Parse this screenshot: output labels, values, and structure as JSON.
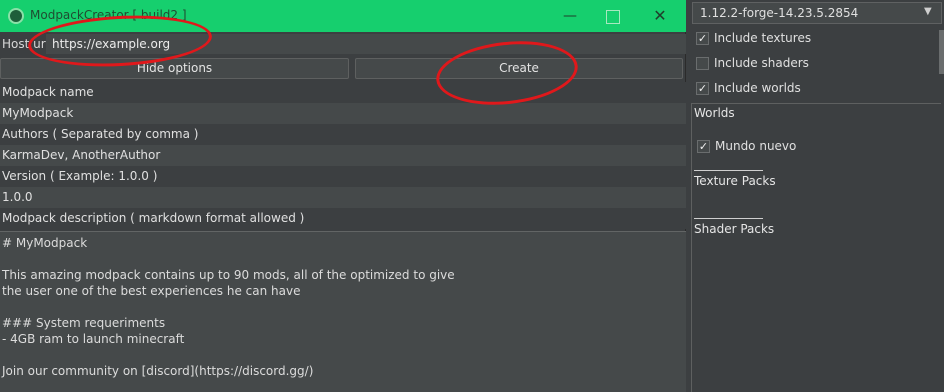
{
  "window": {
    "title": "ModpackCreator [ build2 ]",
    "minimize_glyph": "—",
    "close_glyph": "✕"
  },
  "host": {
    "label": "Host url",
    "value": "https://example.org"
  },
  "buttons": {
    "hide": "Hide options",
    "create": "Create"
  },
  "form": {
    "name_label": "Modpack name",
    "name_value": "MyModpack",
    "authors_label": "Authors ( Separated by comma )",
    "authors_value": "KarmaDev, AnotherAuthor",
    "version_label": "Version ( Example: 1.0.0 )",
    "version_value": "1.0.0",
    "description_label": "Modpack description ( markdown format allowed )",
    "description_value": "# MyModpack\n\nThis amazing modpack contains up to 90 mods, all of the optimized to give\nthe user one of the best experiences he can have\n\n### System requeriments\n- 4GB ram to launch minecraft\n\nJoin our community on [discord](https://discord.gg/)"
  },
  "side": {
    "version_selected": "1.12.2-forge-14.23.5.2854",
    "include_textures": {
      "label": "Include textures",
      "checked": true
    },
    "include_shaders": {
      "label": "Include shaders",
      "checked": false
    },
    "include_worlds": {
      "label": "Include worlds",
      "checked": true
    },
    "worlds_title": "Worlds",
    "world_item": {
      "label": "Mundo nuevo",
      "checked": true
    },
    "texture_packs_title": "Texture Packs",
    "shader_packs_title": "Shader Packs",
    "check_glyph": "✓"
  },
  "colors": {
    "titlebar": "#16cf6e",
    "background": "#3c3f41",
    "field": "#45494a",
    "annotation": "#e0181b"
  }
}
